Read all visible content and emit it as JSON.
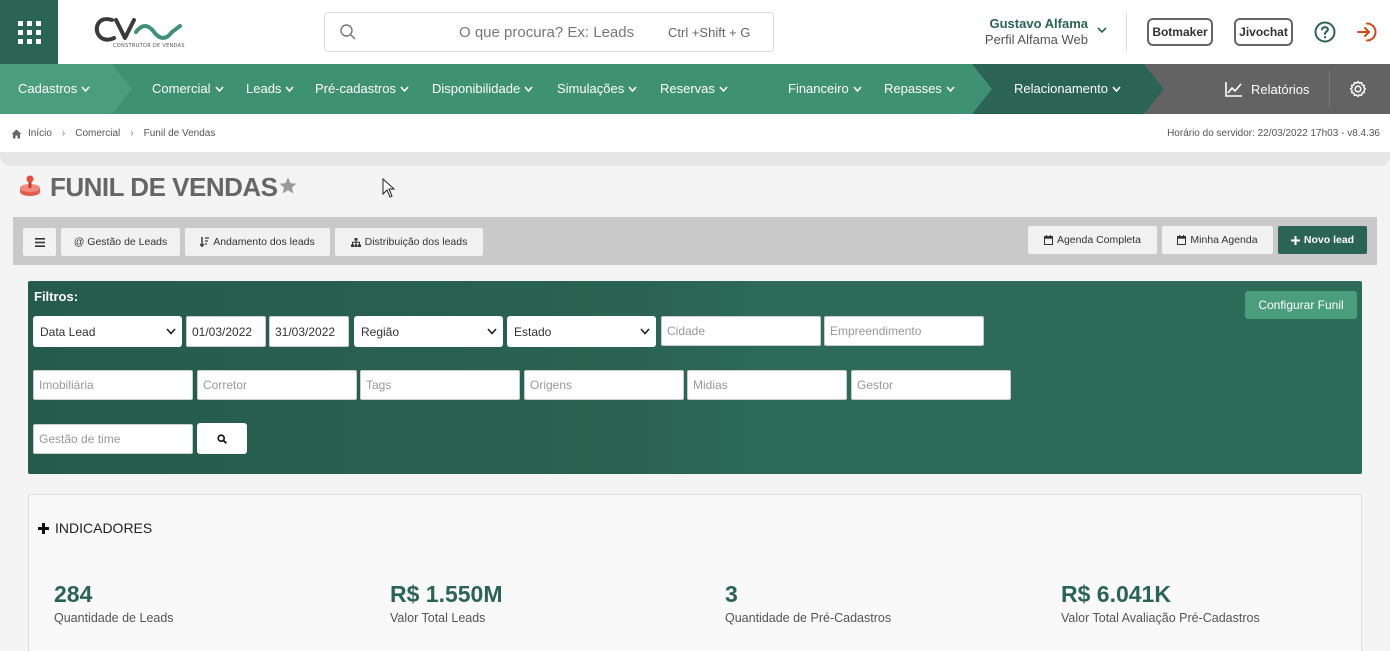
{
  "header": {
    "search_placeholder": "O que procura? Ex: Leads",
    "search_shortcut": "Ctrl +Shift + G",
    "logo_sub": "CONSTRUTOR DE VENDAS",
    "user_name": "Gustavo Alfama",
    "user_profile": "Perfil Alfama Web",
    "botmaker": "Botmaker",
    "jivochat": "Jivochat"
  },
  "nav": {
    "cadastros": "Cadastros",
    "comercial": "Comercial",
    "leads": "Leads",
    "pre_cadastros": "Pré-cadastros",
    "disponibilidade": "Disponibilidade",
    "simulacoes": "Simulações",
    "reservas": "Reservas",
    "financeiro": "Financeiro",
    "repasses": "Repasses",
    "relacionamento": "Relacionamento",
    "relatorios": "Relatórios"
  },
  "breadcrumb": {
    "home": "Início",
    "comercial": "Comercial",
    "current": "Funil de Vendas",
    "server_time": "Horário do servidor: 22/03/2022 17h03 - v8.4.36"
  },
  "page": {
    "title": "FUNIL DE VENDAS"
  },
  "toolbar": {
    "gestao": "@ Gestão de Leads",
    "andamento": "Andamento dos leads",
    "distribuicao": "Distribuição dos leads",
    "agenda_completa": "Agenda Completa",
    "minha_agenda": "Minha Agenda",
    "novo_lead": "Novo lead"
  },
  "filters": {
    "label": "Filtros:",
    "configurar": "Configurar Funil",
    "date_type": "Data Lead",
    "date_from": "01/03/2022",
    "date_to": "31/03/2022",
    "regiao": "Região",
    "estado": "Estado",
    "cidade": "Cidade",
    "empreendimento": "Empreendimento",
    "imobiliaria": "Imobiliária",
    "corretor": "Corretor",
    "tags": "Tags",
    "origens": "Origens",
    "midias": "Midias",
    "gestor": "Gestor",
    "gestao_time": "Gestão de time"
  },
  "indicators": {
    "title": "INDICADORES",
    "items": [
      {
        "value": "284",
        "label": "Quantidade de Leads"
      },
      {
        "value": "R$ 1.550M",
        "label": "Valor Total Leads"
      },
      {
        "value": "3",
        "label": "Quantidade de Pré-Cadastros"
      },
      {
        "value": "R$ 6.041K",
        "label": "Valor Total Avaliação Pré-Cadastros"
      }
    ]
  },
  "colors": {
    "brand_dark": "#2b6355",
    "nav_green": "#3f9173",
    "accent_green": "#4a9d7d",
    "logout_red": "#d04a1c"
  }
}
